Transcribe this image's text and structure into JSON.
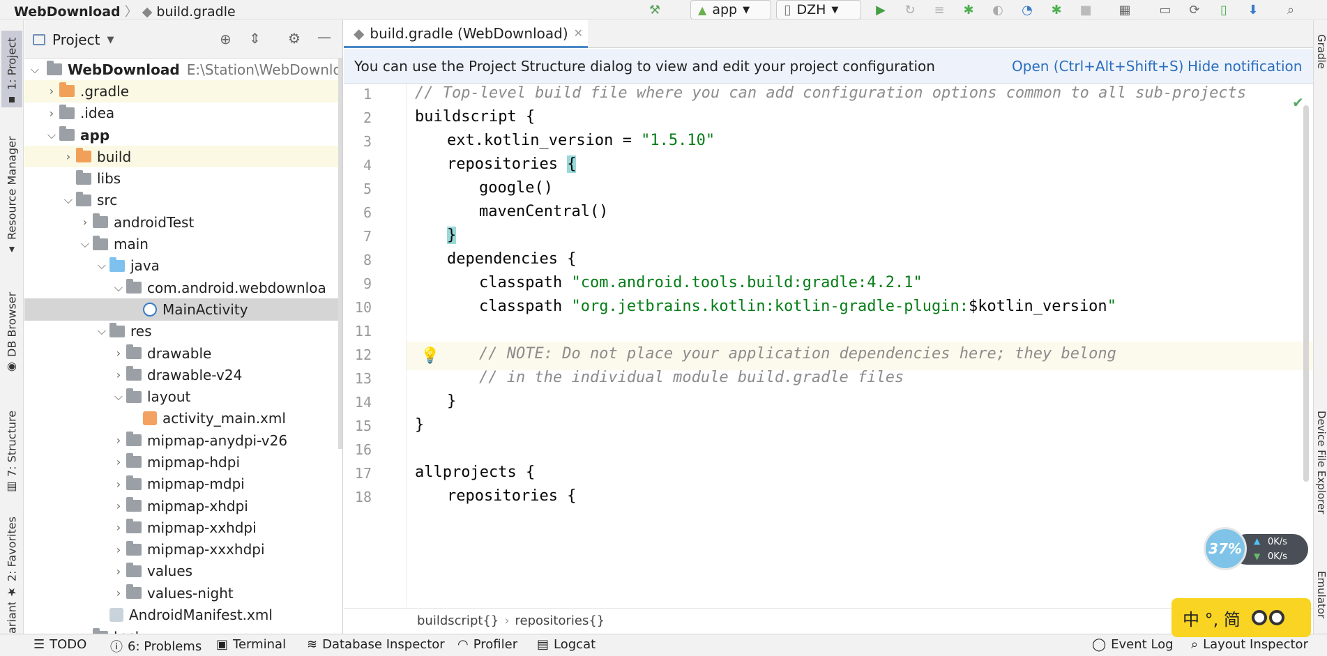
{
  "topbar": {
    "project_name": "WebDownload",
    "file_name": "build.gradle",
    "run_config": "app",
    "device": "DZH"
  },
  "left_tabs": [
    "1: Project",
    "Resource Manager",
    "DB Browser",
    "7: Structure",
    "2: Favorites",
    "ariants"
  ],
  "right_tabs": [
    "Gradle",
    "Device File Explorer",
    "Emulator"
  ],
  "project_panel": {
    "title": "Project",
    "root_name": "WebDownload",
    "root_path": "E:\\Station\\WebDownloa",
    "items": [
      {
        "label": ".gradle",
        "depth": 1,
        "chevron": "right",
        "icon": "folder-orange",
        "highlight": true
      },
      {
        "label": ".idea",
        "depth": 1,
        "chevron": "right",
        "icon": "folder"
      },
      {
        "label": "app",
        "depth": 1,
        "chevron": "down",
        "icon": "module-folder",
        "bold": true
      },
      {
        "label": "build",
        "depth": 2,
        "chevron": "right",
        "icon": "folder-orange",
        "highlight": true
      },
      {
        "label": "libs",
        "depth": 2,
        "chevron": "",
        "icon": "folder"
      },
      {
        "label": "src",
        "depth": 2,
        "chevron": "down",
        "icon": "folder"
      },
      {
        "label": "androidTest",
        "depth": 3,
        "chevron": "right",
        "icon": "folder"
      },
      {
        "label": "main",
        "depth": 3,
        "chevron": "down",
        "icon": "folder"
      },
      {
        "label": "java",
        "depth": 4,
        "chevron": "down",
        "icon": "folder-blue"
      },
      {
        "label": "com.android.webdownloa",
        "depth": 5,
        "chevron": "down",
        "icon": "package"
      },
      {
        "label": "MainActivity",
        "depth": 6,
        "chevron": "",
        "icon": "class",
        "selected": true
      },
      {
        "label": "res",
        "depth": 4,
        "chevron": "down",
        "icon": "res-folder"
      },
      {
        "label": "drawable",
        "depth": 5,
        "chevron": "right",
        "icon": "folder"
      },
      {
        "label": "drawable-v24",
        "depth": 5,
        "chevron": "right",
        "icon": "folder"
      },
      {
        "label": "layout",
        "depth": 5,
        "chevron": "down",
        "icon": "folder"
      },
      {
        "label": "activity_main.xml",
        "depth": 6,
        "chevron": "",
        "icon": "xml"
      },
      {
        "label": "mipmap-anydpi-v26",
        "depth": 5,
        "chevron": "right",
        "icon": "folder"
      },
      {
        "label": "mipmap-hdpi",
        "depth": 5,
        "chevron": "right",
        "icon": "folder"
      },
      {
        "label": "mipmap-mdpi",
        "depth": 5,
        "chevron": "right",
        "icon": "folder"
      },
      {
        "label": "mipmap-xhdpi",
        "depth": 5,
        "chevron": "right",
        "icon": "folder"
      },
      {
        "label": "mipmap-xxhdpi",
        "depth": 5,
        "chevron": "right",
        "icon": "folder"
      },
      {
        "label": "mipmap-xxxhdpi",
        "depth": 5,
        "chevron": "right",
        "icon": "folder"
      },
      {
        "label": "values",
        "depth": 5,
        "chevron": "right",
        "icon": "folder"
      },
      {
        "label": "values-night",
        "depth": 5,
        "chevron": "right",
        "icon": "folder"
      },
      {
        "label": "AndroidManifest.xml",
        "depth": 4,
        "chevron": "",
        "icon": "manifest"
      },
      {
        "label": "test",
        "depth": 3,
        "chevron": "right",
        "icon": "folder"
      }
    ]
  },
  "editor": {
    "tab_label": "build.gradle (WebDownload)",
    "notification": {
      "text": "You can use the Project Structure dialog to view and edit your project configuration",
      "open_link": "Open (Ctrl+Alt+Shift+S)",
      "hide_link": "Hide notification"
    },
    "lines": [
      {
        "n": "1",
        "indent": 0,
        "parts": [
          {
            "t": "// Top-level build file where you can add configuration options common to all sub-projects",
            "c": "cmt"
          }
        ]
      },
      {
        "n": "2",
        "indent": 0,
        "parts": [
          {
            "t": "buildscript {",
            "c": ""
          }
        ]
      },
      {
        "n": "3",
        "indent": 1,
        "parts": [
          {
            "t": "ext.kotlin_version = ",
            "c": ""
          },
          {
            "t": "\"1.5.10\"",
            "c": "str"
          }
        ]
      },
      {
        "n": "4",
        "indent": 1,
        "parts": [
          {
            "t": "repositories ",
            "c": ""
          },
          {
            "t": "{",
            "c": "brm"
          }
        ]
      },
      {
        "n": "5",
        "indent": 2,
        "parts": [
          {
            "t": "google()",
            "c": ""
          }
        ]
      },
      {
        "n": "6",
        "indent": 2,
        "parts": [
          {
            "t": "mavenCentral()",
            "c": ""
          }
        ]
      },
      {
        "n": "7",
        "indent": 1,
        "parts": [
          {
            "t": "}",
            "c": "brm"
          }
        ]
      },
      {
        "n": "8",
        "indent": 1,
        "parts": [
          {
            "t": "dependencies {",
            "c": ""
          }
        ]
      },
      {
        "n": "9",
        "indent": 2,
        "parts": [
          {
            "t": "classpath ",
            "c": ""
          },
          {
            "t": "\"com.android.tools.build:gradle:4.2.1\"",
            "c": "str"
          }
        ]
      },
      {
        "n": "10",
        "indent": 2,
        "parts": [
          {
            "t": "classpath ",
            "c": ""
          },
          {
            "t": "\"org.jetbrains.kotlin:kotlin-gradle-plugin:",
            "c": "str"
          },
          {
            "t": "$kotlin_version",
            "c": ""
          },
          {
            "t": "\"",
            "c": "str"
          }
        ]
      },
      {
        "n": "11",
        "indent": 0,
        "parts": []
      },
      {
        "n": "12",
        "indent": 2,
        "parts": [
          {
            "t": "// NOTE: Do not place your application dependencies here; they belong",
            "c": "cmt"
          }
        ]
      },
      {
        "n": "13",
        "indent": 2,
        "parts": [
          {
            "t": "// in the individual module build.gradle files",
            "c": "cmt"
          }
        ]
      },
      {
        "n": "14",
        "indent": 1,
        "parts": [
          {
            "t": "}",
            "c": ""
          }
        ]
      },
      {
        "n": "15",
        "indent": 0,
        "parts": [
          {
            "t": "}",
            "c": ""
          }
        ]
      },
      {
        "n": "16",
        "indent": 0,
        "parts": []
      },
      {
        "n": "17",
        "indent": 0,
        "parts": [
          {
            "t": "allprojects {",
            "c": ""
          }
        ]
      },
      {
        "n": "18",
        "indent": 1,
        "parts": [
          {
            "t": "repositories {",
            "c": ""
          }
        ]
      }
    ],
    "breadcrumbs": [
      "buildscript{}",
      "repositories{}"
    ]
  },
  "bottombar": {
    "items": [
      "TODO",
      "6: Problems",
      "Terminal",
      "Database Inspector",
      "Profiler",
      "Logcat"
    ],
    "right_items": [
      "Event Log",
      "Layout Inspector"
    ]
  },
  "overlays": {
    "net_percent": "37%",
    "up_speed": "0K/s",
    "down_speed": "0K/s",
    "ime_text": "中 °, 简"
  },
  "colors": {
    "accent": "#4a88c7",
    "link": "#2a6ebd",
    "string": "#067d17",
    "comment": "#8c8c8c",
    "highlight_row": "#fbf9e3",
    "selected_row": "#d5d5d5"
  }
}
